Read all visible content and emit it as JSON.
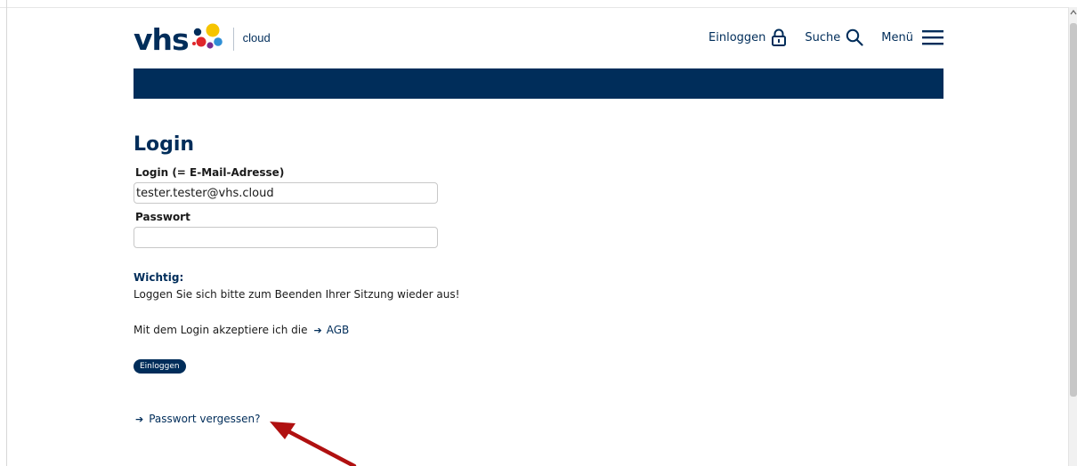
{
  "header": {
    "logo_text": "vhs",
    "logo_suffix": "cloud",
    "nav": [
      {
        "label": "Einloggen",
        "icon": "lock-icon"
      },
      {
        "label": "Suche",
        "icon": "search-icon"
      },
      {
        "label": "Menü",
        "icon": "hamburger-menu-icon"
      }
    ]
  },
  "main": {
    "title": "Login",
    "email_label": "Login (= E-Mail-Adresse)",
    "email_value": "tester.tester@vhs.cloud",
    "password_label": "Passwort",
    "password_value": "",
    "important_heading": "Wichtig:",
    "important_text": "Loggen Sie sich bitte zum Beenden Ihrer Sitzung wieder aus!",
    "terms_text": "Mit dem Login akzeptiere ich die",
    "terms_arrow": "➔",
    "terms_link": "AGB",
    "login_button": "Einloggen",
    "forgot_arrow": "➔",
    "forgot_link": "Passwort vergessen?"
  },
  "colors": {
    "brand": "#002d5a",
    "annotation_arrow": "#b01010"
  }
}
